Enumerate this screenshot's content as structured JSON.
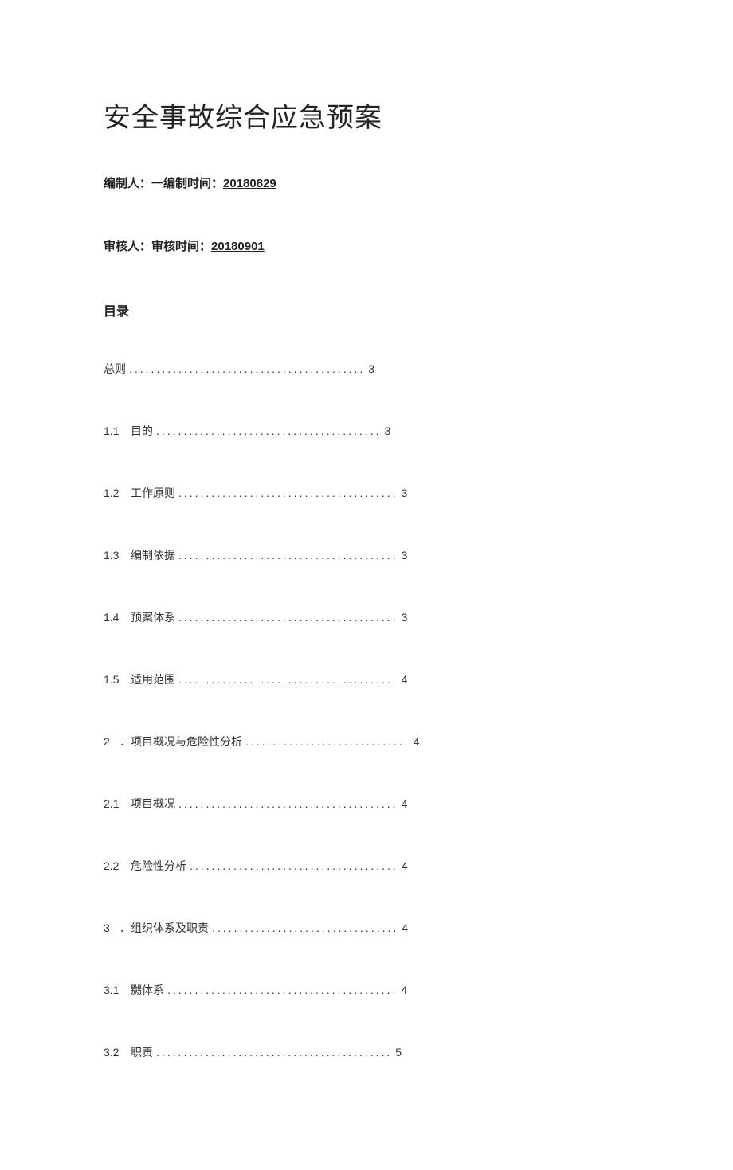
{
  "title": "安全事故综合应急预案",
  "meta": {
    "line1_prefix": "编制人：一编制时间：",
    "line1_date": "20180829",
    "line2_prefix": "审核人：审核时间：",
    "line2_date": "20180901"
  },
  "toc_header": "目录",
  "toc": [
    {
      "num": "",
      "label": "总则",
      "dots": "...........................................",
      "page": "3",
      "kind": "top"
    },
    {
      "num": "1.1",
      "label": "目的",
      "dots": ".........................................",
      "page": "3",
      "kind": "sub"
    },
    {
      "num": "1.2",
      "label": "工作原则",
      "dots": "........................................",
      "page": "3",
      "kind": "sub"
    },
    {
      "num": "1.3",
      "label": "编制依据",
      "dots": "........................................",
      "page": "3",
      "kind": "sub"
    },
    {
      "num": "1.4",
      "label": "预案体系",
      "dots": "........................................",
      "page": "3",
      "kind": "sub"
    },
    {
      "num": "1.5",
      "label": "适用范围",
      "dots": "........................................",
      "page": "4",
      "kind": "sub"
    },
    {
      "num": "2",
      "label": "．项目概况与危险性分析",
      "dots": "..............................",
      "page": "4",
      "kind": "section"
    },
    {
      "num": "2.1",
      "label": "项目概况",
      "dots": "........................................",
      "page": "4",
      "kind": "sub"
    },
    {
      "num": "2.2",
      "label": "危险性分析",
      "dots": "......................................",
      "page": "4",
      "kind": "sub"
    },
    {
      "num": "3",
      "label": "．组织体系及职责",
      "dots": "..................................",
      "page": "4",
      "kind": "section"
    },
    {
      "num": "3.1",
      "label": "嬲体系",
      "dots": "..........................................",
      "page": "4",
      "kind": "sub"
    },
    {
      "num": "3.2",
      "label": "职责",
      "dots": "...........................................",
      "page": "5",
      "kind": "sub"
    }
  ]
}
